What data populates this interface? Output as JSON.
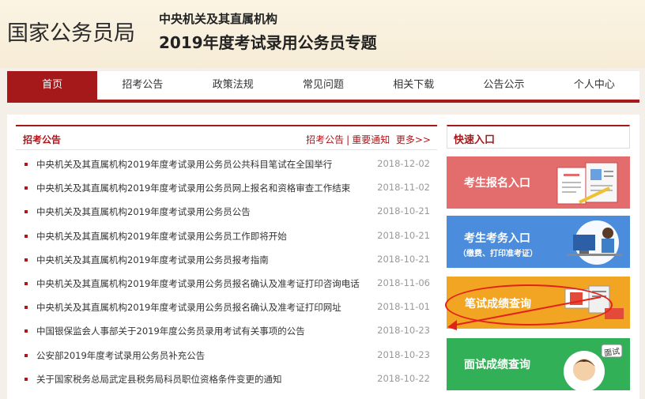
{
  "header": {
    "logo": "国家公务员局",
    "subtitle_line1": "中央机关及其直属机构",
    "subtitle_line2": "2019年度考试录用公务员专题"
  },
  "nav": [
    "首页",
    "招考公告",
    "政策法规",
    "常见问题",
    "相关下载",
    "公告公示",
    "个人中心"
  ],
  "news": {
    "title": "招考公告",
    "link1": "招考公告",
    "sep": "|",
    "link2": "重要通知",
    "more": "更多>>",
    "items": [
      {
        "title": "中央机关及其直属机构2019年度考试录用公务员公共科目笔试在全国举行",
        "date": "2018-12-02"
      },
      {
        "title": "中央机关及其直属机构2019年度考试录用公务员网上报名和资格审查工作结束",
        "date": "2018-11-02"
      },
      {
        "title": "中央机关及其直属机构2019年度考试录用公务员公告",
        "date": "2018-10-21"
      },
      {
        "title": "中央机关及其直属机构2019年度考试录用公务员工作即将开始",
        "date": "2018-10-21"
      },
      {
        "title": "中央机关及其直属机构2019年度考试录用公务员报考指南",
        "date": "2018-10-21"
      },
      {
        "title": "中央机关及其直属机构2019年度考试录用公务员报名确认及准考证打印咨询电话",
        "date": "2018-11-06"
      },
      {
        "title": "中央机关及其直属机构2019年度考试录用公务员报名确认及准考证打印网址",
        "date": "2018-11-01"
      },
      {
        "title": "中国银保监会人事部关于2019年度公务员录用考试有关事项的公告",
        "date": "2018-10-23"
      },
      {
        "title": "公安部2019年度考试录用公务员补充公告",
        "date": "2018-10-23"
      },
      {
        "title": "关于国家税务总局武定县税务局科员职位资格条件变更的通知",
        "date": "2018-10-22"
      }
    ]
  },
  "quick": {
    "title": "快速入口",
    "card1": "考生报名入口",
    "card2": "考生考务入口",
    "card2_sub": "（缴费、打印准考证）",
    "card3": "笔试成绩查询",
    "card4": "面试成绩查询",
    "card4_badge": "面试"
  },
  "colors": {
    "brand_red": "#a6191b",
    "card1": "#e36d6d",
    "card2": "#4b8ddc",
    "card3": "#f1a523",
    "card4": "#32b057"
  }
}
